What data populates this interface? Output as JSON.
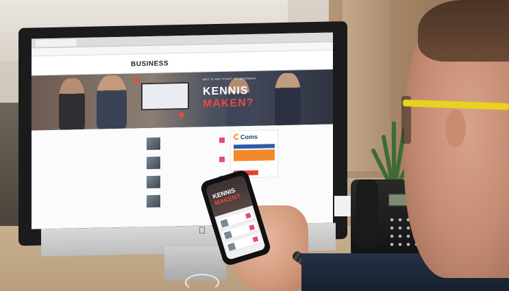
{
  "browser": {
    "tab_label": "",
    "url": ""
  },
  "website": {
    "logo_kicker": "",
    "logo": "BUSINESS",
    "nav": [],
    "hero": {
      "kicker": "WAT IS HET POINT OF BUSINESS",
      "title_line1": "KENNIS",
      "title_line2": "MAKEN?"
    },
    "section_title": "",
    "sidebar_brand": "Coms"
  },
  "phone_screen": {
    "title_line1": "KENNIS",
    "title_line2": "MAKEN?"
  },
  "monitor": {
    "logo": ""
  },
  "colors": {
    "accent_red": "#e74c3c",
    "accent_pink": "#e6487a",
    "brand_orange": "#f2892b",
    "brand_blue": "#2d5da8",
    "glasses_yellow": "#e7d31e"
  }
}
